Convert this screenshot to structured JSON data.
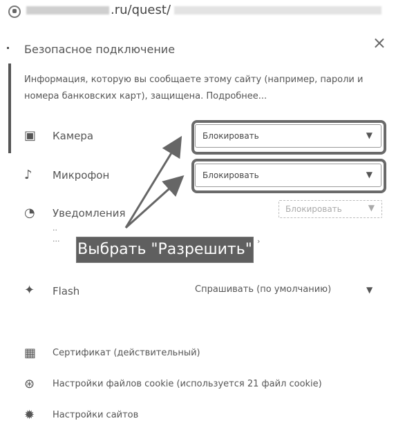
{
  "address": {
    "url_fragment": ".ru/quest/"
  },
  "panel": {
    "title": "Безопасное подключение",
    "close": "×",
    "description": "Информация, которую вы сообщаете этому сайту (например, пароли и номера банковских карт), защищена. Подробнее..."
  },
  "permissions": [
    {
      "label": "Камера",
      "value": "Блокировать",
      "icon": "camera-icon"
    },
    {
      "label": "Микрофон",
      "value": "Блокировать",
      "icon": "microphone-icon"
    },
    {
      "label": "Уведомления",
      "value": "Блокировать",
      "icon": "notification-icon"
    }
  ],
  "annotation": {
    "callout": "Выбрать \"Разрешить\""
  },
  "flash": {
    "label": "Flash",
    "value": "Спрашивать (по умолчанию)",
    "icon": "puzzle-icon"
  },
  "links": [
    {
      "label": "Сертификат (действительный)",
      "icon": "certificate-icon"
    },
    {
      "label": "Настройки файлов cookie (используется 21 файл cookie)",
      "icon": "cookie-icon"
    },
    {
      "label": "Настройки сайтов",
      "icon": "gear-icon"
    }
  ],
  "colors": {
    "annotation_gray": "#6a6a6a",
    "callout_bg": "#5f5f5f"
  }
}
